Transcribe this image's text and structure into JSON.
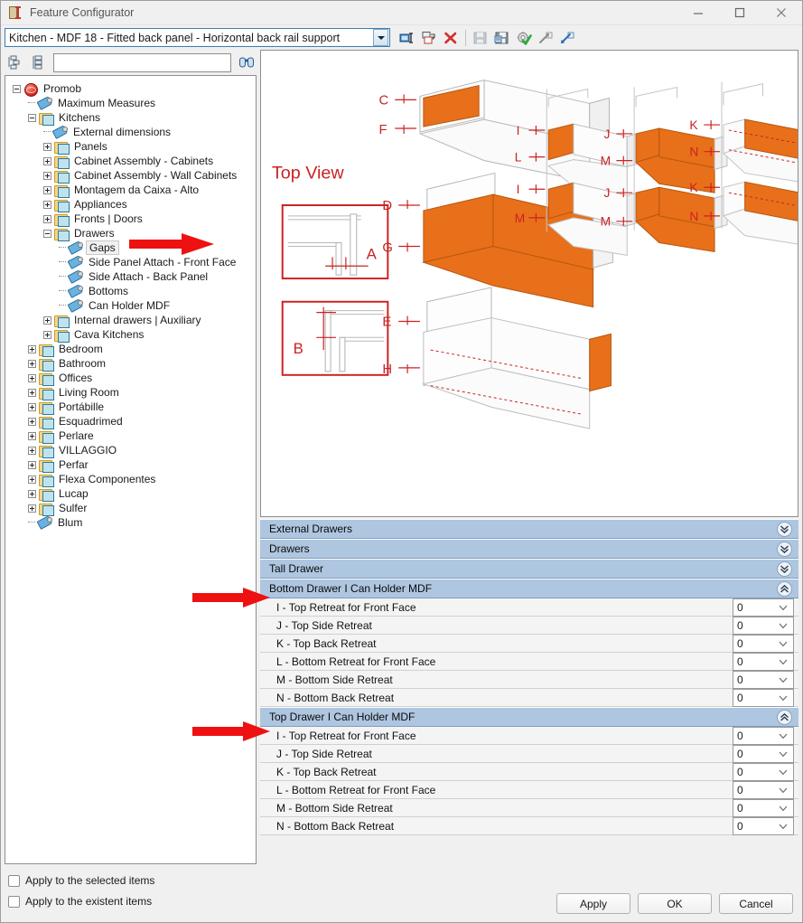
{
  "window": {
    "title": "Feature Configurator",
    "icon": "configurator-icon",
    "minimize_label": "Minimize",
    "maximize_label": "Maximize",
    "close_label": "Close"
  },
  "combo": {
    "value": "Kitchen - MDF 18 - Fitted back panel - Horizontal back rail support",
    "dropdown_label": "Open configuration list"
  },
  "toolbar": {
    "items": [
      {
        "name": "rename-icon",
        "label": "Rename"
      },
      {
        "name": "duplicate-icon",
        "label": "Duplicate"
      },
      {
        "name": "delete-icon",
        "label": "Delete"
      },
      {
        "name": "save-icon",
        "label": "Save"
      },
      {
        "name": "save-as-icon",
        "label": "Save As"
      },
      {
        "name": "validate-settings-icon",
        "label": "Validate"
      },
      {
        "name": "export-icon",
        "label": "Export"
      },
      {
        "name": "import-icon",
        "label": "Import"
      }
    ]
  },
  "tree_tools": {
    "expand_all_label": "Expand all",
    "collapse_all_label": "Collapse all",
    "find_label": "Find",
    "search_value": "",
    "search_placeholder": ""
  },
  "tree": {
    "selected": "Gaps",
    "nodes": [
      {
        "label": "Promob",
        "depth": 0,
        "icon": "globe",
        "expander": "minus"
      },
      {
        "label": "Maximum Measures",
        "depth": 1,
        "icon": "tag",
        "expander": "none"
      },
      {
        "label": "Kitchens",
        "depth": 1,
        "icon": "folder",
        "expander": "minus"
      },
      {
        "label": "External dimensions",
        "depth": 2,
        "icon": "tag",
        "expander": "none"
      },
      {
        "label": "Panels",
        "depth": 2,
        "icon": "folder",
        "expander": "plus"
      },
      {
        "label": "Cabinet Assembly - Cabinets",
        "depth": 2,
        "icon": "folder",
        "expander": "plus"
      },
      {
        "label": "Cabinet Assembly - Wall Cabinets",
        "depth": 2,
        "icon": "folder",
        "expander": "plus"
      },
      {
        "label": "Montagem da Caixa - Alto",
        "depth": 2,
        "icon": "folder",
        "expander": "plus"
      },
      {
        "label": "Appliances",
        "depth": 2,
        "icon": "folder",
        "expander": "plus"
      },
      {
        "label": "Fronts | Doors",
        "depth": 2,
        "icon": "folder",
        "expander": "plus"
      },
      {
        "label": "Drawers",
        "depth": 2,
        "icon": "folder",
        "expander": "minus"
      },
      {
        "label": "Gaps",
        "depth": 3,
        "icon": "tag",
        "expander": "none",
        "selected": true
      },
      {
        "label": "Side Panel Attach - Front Face",
        "depth": 3,
        "icon": "tag",
        "expander": "none"
      },
      {
        "label": "Side Attach - Back Panel",
        "depth": 3,
        "icon": "tag",
        "expander": "none"
      },
      {
        "label": "Bottoms",
        "depth": 3,
        "icon": "tag",
        "expander": "none"
      },
      {
        "label": "Can Holder MDF",
        "depth": 3,
        "icon": "tag",
        "expander": "none"
      },
      {
        "label": "Internal drawers | Auxiliary",
        "depth": 2,
        "icon": "folder",
        "expander": "plus"
      },
      {
        "label": "Cava Kitchens",
        "depth": 2,
        "icon": "folder",
        "expander": "plus"
      },
      {
        "label": "Bedroom",
        "depth": 1,
        "icon": "folder",
        "expander": "plus"
      },
      {
        "label": "Bathroom",
        "depth": 1,
        "icon": "folder",
        "expander": "plus"
      },
      {
        "label": "Offices",
        "depth": 1,
        "icon": "folder",
        "expander": "plus"
      },
      {
        "label": "Living Room",
        "depth": 1,
        "icon": "folder",
        "expander": "plus"
      },
      {
        "label": "Portábille",
        "depth": 1,
        "icon": "folder",
        "expander": "plus"
      },
      {
        "label": "Esquadrimed",
        "depth": 1,
        "icon": "folder",
        "expander": "plus"
      },
      {
        "label": "Perlare",
        "depth": 1,
        "icon": "folder",
        "expander": "plus"
      },
      {
        "label": "VILLAGGIO",
        "depth": 1,
        "icon": "folder",
        "expander": "plus"
      },
      {
        "label": "Perfar",
        "depth": 1,
        "icon": "folder",
        "expander": "plus"
      },
      {
        "label": "Flexa Componentes",
        "depth": 1,
        "icon": "folder",
        "expander": "plus"
      },
      {
        "label": "Lucap",
        "depth": 1,
        "icon": "folder",
        "expander": "plus"
      },
      {
        "label": "Sulfer",
        "depth": 1,
        "icon": "folder",
        "expander": "plus"
      },
      {
        "label": "Blum",
        "depth": 1,
        "icon": "tag",
        "expander": "none"
      }
    ]
  },
  "preview": {
    "caption": "Top View",
    "accent_color": "#e8701a",
    "annotation_color": "#cc2222",
    "callouts": [
      "A",
      "B",
      "C",
      "D",
      "E",
      "F",
      "G",
      "H",
      "I",
      "J",
      "K",
      "L",
      "M",
      "N"
    ]
  },
  "accordion": [
    {
      "title": "External Drawers",
      "expanded": false,
      "chevron": "chevron-double-down"
    },
    {
      "title": "Drawers",
      "expanded": false,
      "chevron": "chevron-double-down"
    },
    {
      "title": "Tall Drawer",
      "expanded": false,
      "chevron": "chevron-double-down"
    },
    {
      "title": "Bottom Drawer I Can Holder MDF",
      "expanded": true,
      "chevron": "chevron-double-up",
      "annotated": true,
      "rows": [
        {
          "label": "I - Top Retreat for Front Face",
          "value": "0"
        },
        {
          "label": "J - Top Side Retreat",
          "value": "0"
        },
        {
          "label": "K - Top Back Retreat",
          "value": "0"
        },
        {
          "label": "L - Bottom Retreat for Front Face",
          "value": "0"
        },
        {
          "label": "M - Bottom Side Retreat",
          "value": "0"
        },
        {
          "label": "N - Bottom Back Retreat",
          "value": "0"
        }
      ]
    },
    {
      "title": "Top Drawer I Can Holder MDF",
      "expanded": true,
      "chevron": "chevron-double-up",
      "annotated": true,
      "rows": [
        {
          "label": "I - Top Retreat for Front Face",
          "value": "0"
        },
        {
          "label": "J - Top Side Retreat",
          "value": "0"
        },
        {
          "label": "K - Top Back Retreat",
          "value": "0"
        },
        {
          "label": "L - Bottom Retreat for Front Face",
          "value": "0"
        },
        {
          "label": "M - Bottom Side Retreat",
          "value": "0"
        },
        {
          "label": "N - Bottom Back Retreat",
          "value": "0"
        }
      ]
    }
  ],
  "footer": {
    "checkbox_selected": "Apply to the selected items",
    "checkbox_existent": "Apply to the existent items",
    "apply_label": "Apply",
    "ok_label": "OK",
    "cancel_label": "Cancel"
  }
}
